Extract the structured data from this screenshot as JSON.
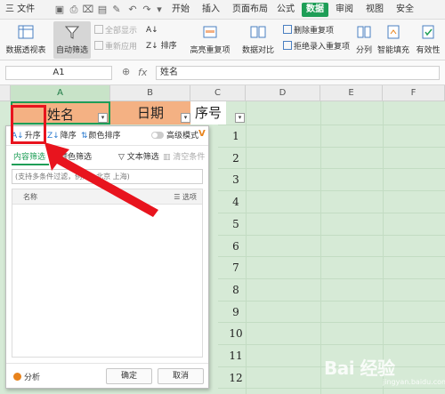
{
  "menubar": {
    "file_label": "三 文件",
    "tabs": [
      "开始",
      "插入",
      "页面布局",
      "公式",
      "数据",
      "审阅",
      "视图",
      "安全"
    ],
    "active_tab": "数据"
  },
  "ribbon": {
    "pivot_table": "数据透视表",
    "auto_filter": "自动筛选",
    "show_all": "全部显示",
    "reapply": "重新应用",
    "sort": "排序",
    "highlight_dup": "高亮重复项",
    "data_compare": "数据对比",
    "remove_dup": "删除重复项",
    "reject_dup": "拒绝录入重复项",
    "split": "分列",
    "smart_fill": "智能填充",
    "validity": "有效性"
  },
  "formula": {
    "cell_ref": "A1",
    "fx": "fx",
    "value": "姓名"
  },
  "grid": {
    "columns": [
      "A",
      "B",
      "C",
      "D",
      "E",
      "F"
    ],
    "headers": {
      "a1": "姓名",
      "b1": "日期",
      "c1": "序号"
    },
    "row_values": [
      "1",
      "2",
      "3",
      "4",
      "5",
      "6",
      "7",
      "8",
      "9",
      "10",
      "11",
      "12"
    ]
  },
  "filter_panel": {
    "sort_asc": "升序",
    "sort_desc": "降序",
    "sort_color": "颜色排序",
    "advanced_mode": "高级模式",
    "vip": "V",
    "tab_content": "内容筛选",
    "tab_color": "颜色筛选",
    "text_filter": "文本筛选",
    "clear_condition": "清空条件",
    "search_placeholder": "(支持多条件过滤，例如：北京 上海)",
    "col_name": "名称",
    "options": "选项",
    "analysis": "分析",
    "ok": "确定",
    "cancel": "取消"
  },
  "watermark": {
    "text": "Bai 经验",
    "sub": "jingyan.baidu.com"
  },
  "colors": {
    "accent": "#1e9e57",
    "header_fill": "#f4b183",
    "sheet_bg": "#d6ead6",
    "highlight": "#e8141e"
  }
}
